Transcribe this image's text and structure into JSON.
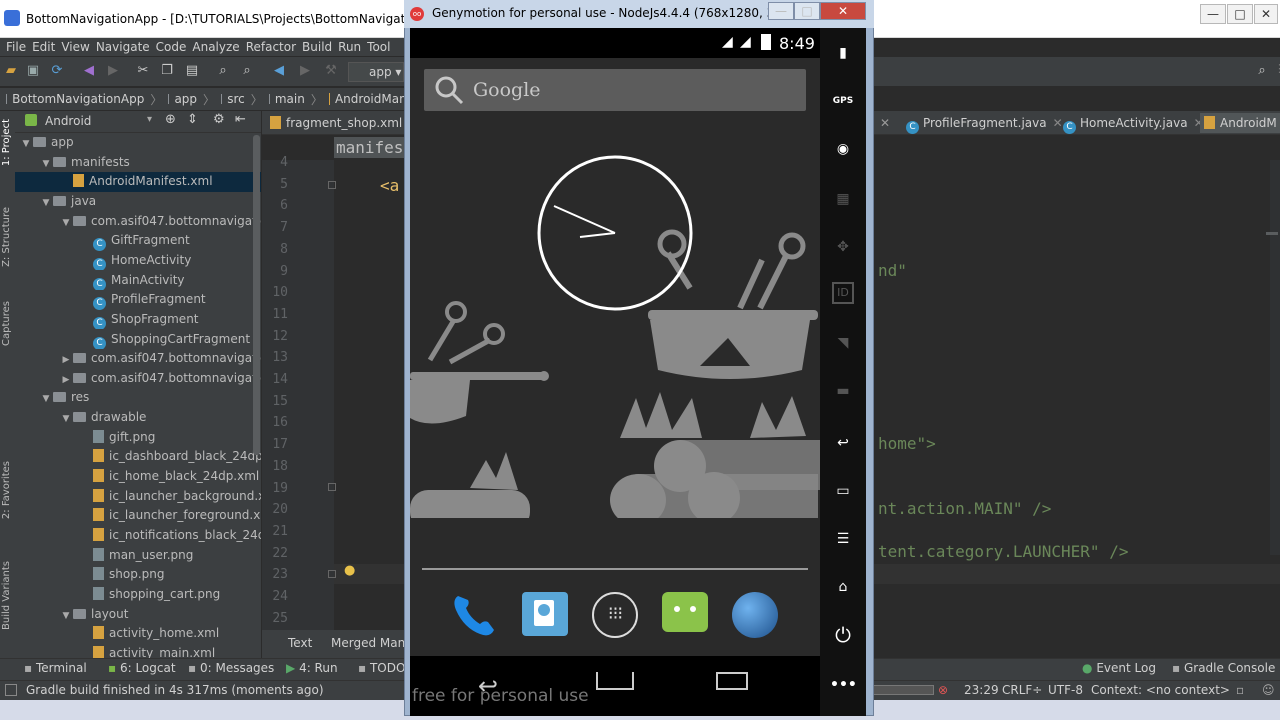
{
  "ide": {
    "title": "BottomNavigationApp - [D:\\TUTORIALS\\Projects\\BottomNavigationApp]",
    "window_buttons": [
      "—",
      "□",
      "✕"
    ],
    "menu": [
      "File",
      "Edit",
      "View",
      "Navigate",
      "Code",
      "Analyze",
      "Refactor",
      "Build",
      "Run",
      "Tool"
    ],
    "toolbar_run_config": "app",
    "breadcrumb": [
      "BottomNavigationApp",
      "app",
      "src",
      "main",
      "AndroidMani"
    ],
    "left_strip": [
      "1: Project",
      "Z: Structure",
      "Captures",
      "2: Favorites",
      "Build Variants"
    ],
    "project_view_mode": "Android",
    "tree": [
      {
        "label": "app",
        "kind": "folder",
        "level": 0,
        "open": true
      },
      {
        "label": "manifests",
        "kind": "folder",
        "level": 1,
        "open": true
      },
      {
        "label": "AndroidManifest.xml",
        "kind": "xml",
        "level": 2,
        "selected": true
      },
      {
        "label": "java",
        "kind": "folder",
        "level": 1,
        "open": true
      },
      {
        "label": "com.asif047.bottomnavigationa",
        "kind": "folder",
        "level": 2,
        "open": true
      },
      {
        "label": "GiftFragment",
        "kind": "class",
        "level": 3
      },
      {
        "label": "HomeActivity",
        "kind": "class",
        "level": 3
      },
      {
        "label": "MainActivity",
        "kind": "class",
        "level": 3
      },
      {
        "label": "ProfileFragment",
        "kind": "class",
        "level": 3
      },
      {
        "label": "ShopFragment",
        "kind": "class",
        "level": 3
      },
      {
        "label": "ShoppingCartFragment",
        "kind": "class",
        "level": 3
      },
      {
        "label": "com.asif047.bottomnavigationa",
        "kind": "folder",
        "level": 2,
        "open": false
      },
      {
        "label": "com.asif047.bottomnavigationa",
        "kind": "folder",
        "level": 2,
        "open": false
      },
      {
        "label": "res",
        "kind": "folder",
        "level": 1,
        "open": true
      },
      {
        "label": "drawable",
        "kind": "folder",
        "level": 2,
        "open": true
      },
      {
        "label": "gift.png",
        "kind": "png",
        "level": 3
      },
      {
        "label": "ic_dashboard_black_24dp.xn",
        "kind": "xml",
        "level": 3
      },
      {
        "label": "ic_home_black_24dp.xml",
        "kind": "xml",
        "level": 3
      },
      {
        "label": "ic_launcher_background.xm",
        "kind": "xml",
        "level": 3
      },
      {
        "label": "ic_launcher_foreground.xml",
        "kind": "xml",
        "level": 3
      },
      {
        "label": "ic_notifications_black_24dp.",
        "kind": "xml",
        "level": 3
      },
      {
        "label": "man_user.png",
        "kind": "png",
        "level": 3
      },
      {
        "label": "shop.png",
        "kind": "png",
        "level": 3
      },
      {
        "label": "shopping_cart.png",
        "kind": "png",
        "level": 3
      },
      {
        "label": "layout",
        "kind": "folder",
        "level": 2,
        "open": true
      },
      {
        "label": "activity_home.xml",
        "kind": "xml",
        "level": 3
      },
      {
        "label": "activity_main.xml",
        "kind": "xml",
        "level": 3
      }
    ],
    "editor_tabs_left": [
      "fragment_shop.xml"
    ],
    "editor_tabs_right": [
      "ProfileFragment.java",
      "HomeActivity.java",
      "AndroidM"
    ],
    "editor_breadcrumb": "manifes",
    "line_numbers": [
      "4",
      "5",
      "6",
      "7",
      "8",
      "9",
      "10",
      "11",
      "12",
      "13",
      "14",
      "15",
      "16",
      "17",
      "18",
      "19",
      "20",
      "21",
      "22",
      "23",
      "24",
      "25"
    ],
    "code_fragments": {
      "line5": "<a",
      "line9": "nd\"",
      "line17": "home\">",
      "line20": "nt.action.MAIN\" />",
      "line22": "tent.category.LAUNCHER\" />"
    },
    "editor_bottom_tabs": [
      "Text",
      "Merged Mani"
    ],
    "tool_windows": [
      "Terminal",
      "6: Logcat",
      "0: Messages",
      "4: Run",
      "TODO",
      "Event Log",
      "Gradle Console"
    ],
    "status": {
      "message": "Gradle build finished in 4s 317ms (moments ago)",
      "position": "23:29",
      "line_sep": "CRLF÷",
      "encoding": "UTF-8",
      "context": "Context: <no context>"
    }
  },
  "emulator": {
    "title": "Genymotion for personal use - NodeJs4.4.4 (768x1280, 320dpi...",
    "time": "8:49",
    "search_label": "Google",
    "watermark": "free for personal use",
    "side_panel": [
      "battery-icon",
      "GPS",
      "camera-icon",
      "clapper-icon",
      "dpad-icon",
      "ID",
      "wifi-icon",
      "sms-icon",
      "back-icon",
      "recent-icon",
      "menu-icon",
      "home-icon",
      "power-icon",
      "more-icon"
    ],
    "gps_label": "GPS",
    "id_label": "ID",
    "dock": [
      "phone-icon",
      "contacts-icon",
      "apps-icon",
      "messaging-icon",
      "browser-icon"
    ],
    "colors": {
      "accent": "#3592c4",
      "wallpaper": "#2a2a2a"
    }
  }
}
